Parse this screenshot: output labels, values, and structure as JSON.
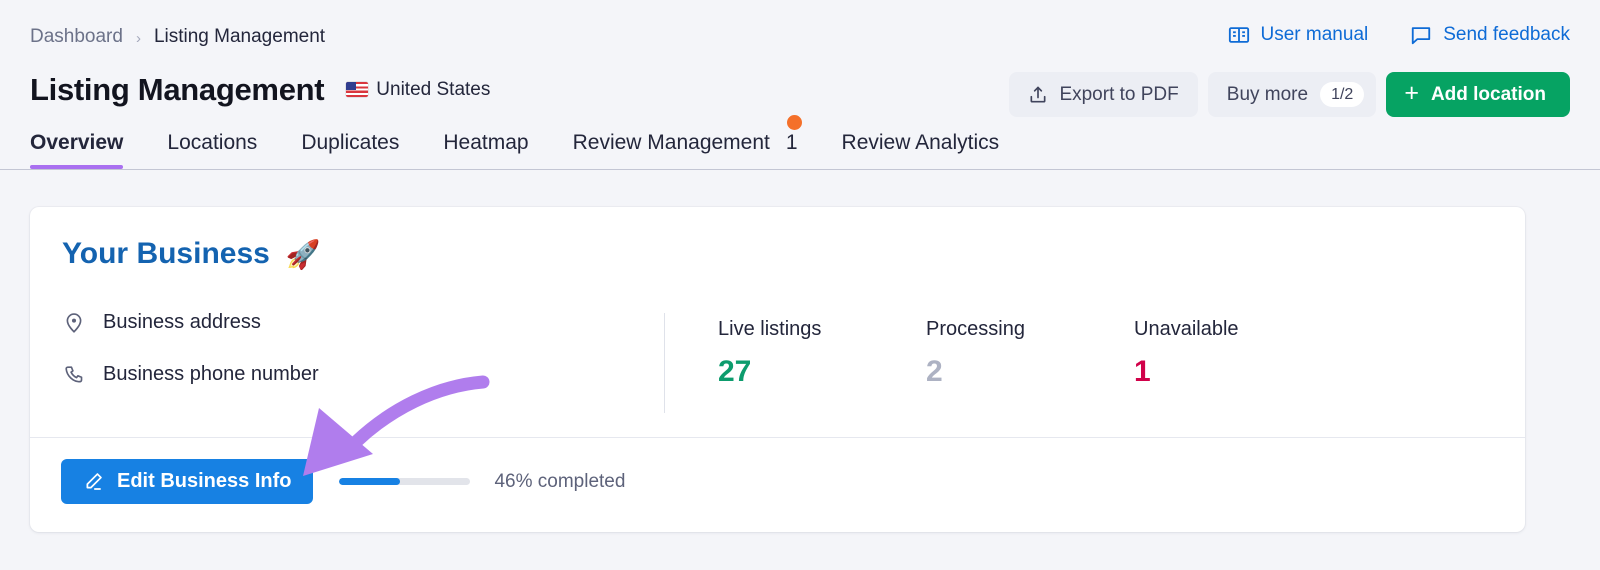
{
  "breadcrumb": {
    "root": "Dashboard",
    "separator": "›",
    "current": "Listing Management"
  },
  "header": {
    "title": "Listing Management",
    "country": "United States",
    "country_flag_icon": "flag-us-icon",
    "links": [
      {
        "label": "User manual",
        "icon": "book-icon"
      },
      {
        "label": "Send feedback",
        "icon": "speech-bubble-icon"
      }
    ],
    "actions": {
      "export_label": "Export to PDF",
      "export_icon": "upload-icon",
      "buy_label": "Buy more",
      "buy_count": "1/2",
      "add_label": "Add location",
      "add_icon": "plus-icon"
    }
  },
  "tabs": [
    {
      "label": "Overview",
      "active": true
    },
    {
      "label": "Locations",
      "active": false
    },
    {
      "label": "Duplicates",
      "active": false
    },
    {
      "label": "Heatmap",
      "active": false
    },
    {
      "label": "Review Management",
      "active": false,
      "badge": "1",
      "dot": true
    },
    {
      "label": "Review Analytics",
      "active": false
    }
  ],
  "card": {
    "title": "Your Business",
    "title_emoji": "🚀",
    "info": [
      {
        "label": "Business address",
        "icon": "location-pin-icon"
      },
      {
        "label": "Business phone number",
        "icon": "phone-icon"
      }
    ],
    "stats": [
      {
        "label": "Live listings",
        "value": "27",
        "tone": "green"
      },
      {
        "label": "Processing",
        "value": "2",
        "tone": "gray"
      },
      {
        "label": "Unavailable",
        "value": "1",
        "tone": "red"
      }
    ],
    "footer": {
      "edit_label": "Edit Business Info",
      "edit_icon": "pencil-icon",
      "progress_percent": 46,
      "progress_text": "46% completed"
    }
  },
  "colors": {
    "page_background": "#f4f5f9",
    "accent_blue": "#1781e3",
    "link_blue": "#0e6bd6",
    "title_blue": "#1463b0",
    "green": "#06a363",
    "stat_green": "#0d9c6d",
    "stat_gray": "#adb2c3",
    "stat_red": "#d1024a",
    "tab_underline_purple": "#a970f0",
    "badge_orange": "#f4702a",
    "annotation_purple": "#b07ded"
  },
  "annotation": {
    "shape": "curved-arrow",
    "points_to": "Edit Business Info",
    "color": "#b07ded"
  }
}
